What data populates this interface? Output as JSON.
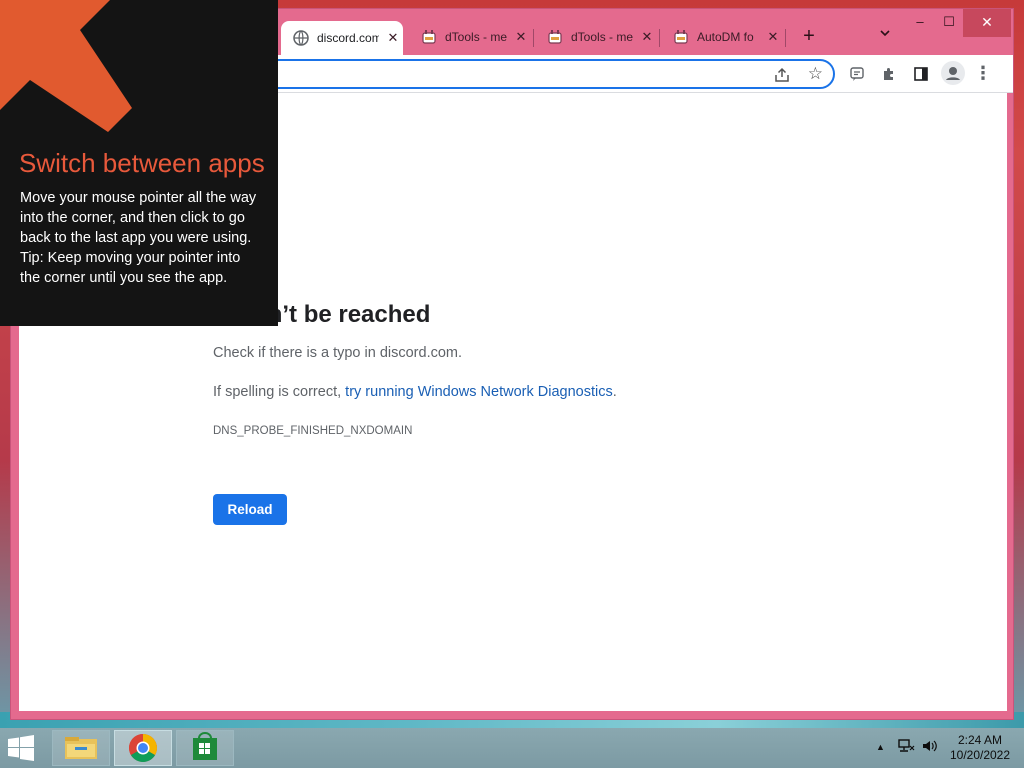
{
  "browser": {
    "tabs": [
      {
        "label": "discord.com",
        "icon": "globe-icon",
        "active": true
      },
      {
        "label": "dTools - me",
        "icon": "dtools-favicon",
        "active": false
      },
      {
        "label": "dTools - me",
        "icon": "dtools-favicon",
        "active": false
      },
      {
        "label": "AutoDM fo",
        "icon": "dtools-favicon",
        "active": false
      }
    ],
    "new_tab": "+",
    "close_glyph": "✕",
    "window_controls": {
      "minimize": "–",
      "maximize": "☐",
      "close": "✕"
    },
    "address_value": ""
  },
  "error_page": {
    "title": "te can’t be reached",
    "check_text": "Check if there is a typo in discord.com.",
    "spelling_prefix": "If spelling is correct, ",
    "diagnostics_link": "try running Windows Network Diagnostics",
    "spelling_suffix": ".",
    "error_code": "DNS_PROBE_FINISHED_NXDOMAIN",
    "reload_label": "Reload"
  },
  "overlay": {
    "title": "Switch between apps",
    "body_lines": [
      "Move your mouse pointer all the way into the corner, and then click to go back to the last app you were using.",
      "Tip: Keep moving your pointer into the corner until you see the app."
    ]
  },
  "taskbar": {
    "apps": [
      "file-explorer-icon",
      "chrome-icon",
      "store-icon"
    ],
    "active_app": "chrome-icon",
    "time": "2:24 AM",
    "date": "10/20/2022"
  },
  "colors": {
    "accent": "#1a73e8",
    "link": "#1a5fb4",
    "overlay_title": "#e8593b",
    "window_frame": "#e46a8e"
  }
}
